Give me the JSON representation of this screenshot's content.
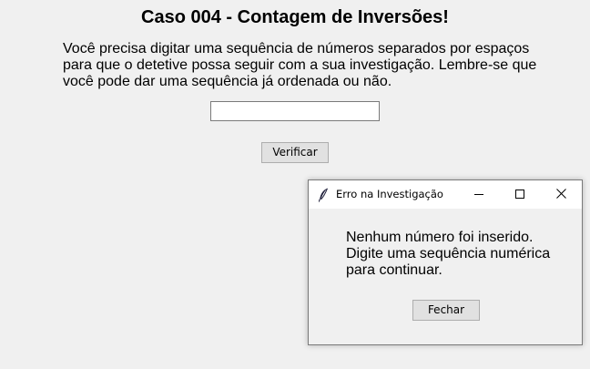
{
  "main": {
    "title": "Caso 004 - Contagem de Inversões!",
    "instructions": [
      "Você precisa digitar uma sequência de números separados por espaços",
      "para que o detetive possa seguir com a sua investigação. Lembre-se que",
      "você pode dar uma sequência já ordenada ou não."
    ],
    "sequence_input_value": "",
    "verify_label": "Verificar"
  },
  "dialog": {
    "title": "Erro na Investigação",
    "icon": "feather-icon",
    "message": [
      "Nenhum número foi inserido.",
      "Digite uma sequência numérica",
      "para continuar."
    ],
    "close_label": "Fechar",
    "controls": [
      "minimize-icon",
      "maximize-icon",
      "close-icon"
    ]
  }
}
